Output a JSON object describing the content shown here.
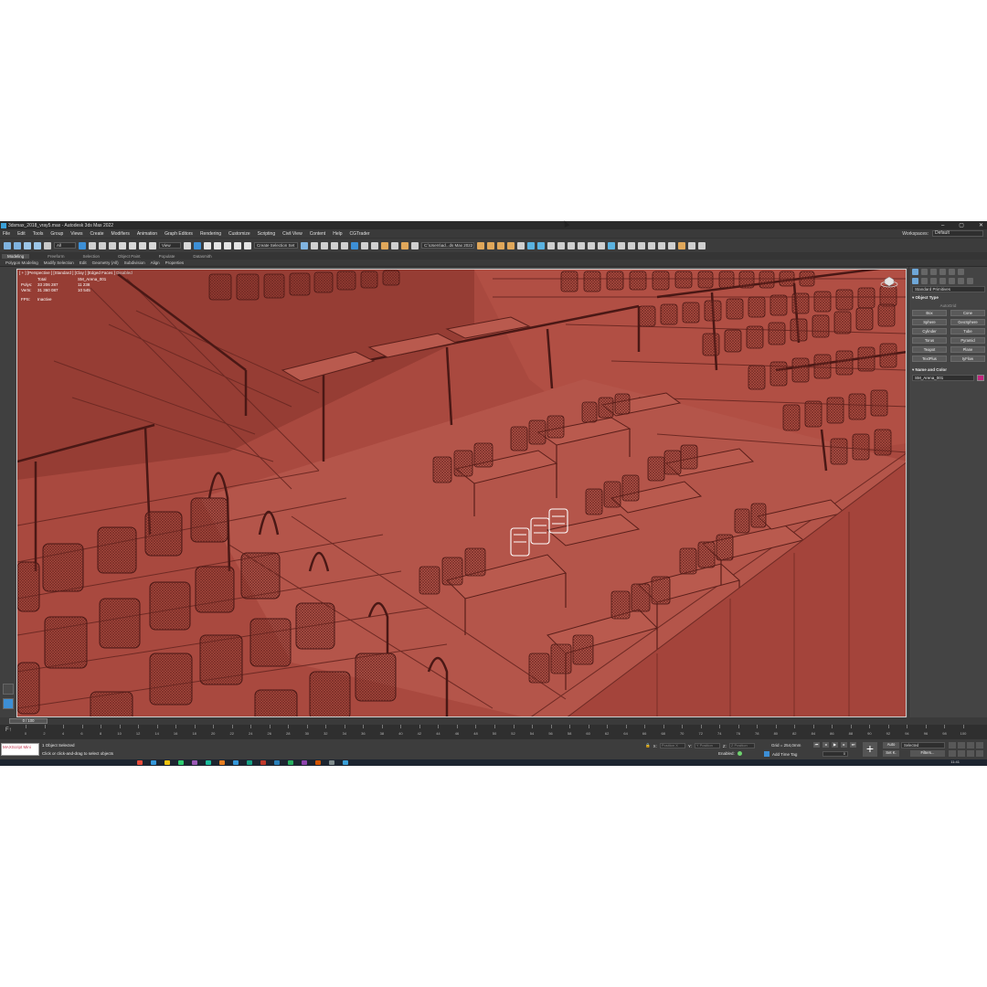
{
  "window": {
    "title": "3dsmax_2018_vray5.max - Autodesk 3ds Max 2022",
    "controls": [
      "–",
      "▢",
      "✕"
    ]
  },
  "menu": {
    "items": [
      "File",
      "Edit",
      "Tools",
      "Group",
      "Views",
      "Create",
      "Modifiers",
      "Animation",
      "Graph Editors",
      "Rendering",
      "Customize",
      "Scripting",
      "Civil View",
      "Content",
      "Help",
      "CGTrader"
    ],
    "workspace_label": "Workspaces:",
    "workspace_value": "Default"
  },
  "toolbar": {
    "filter_value": "All",
    "view_value": "View",
    "selection_set": "Create Selection Set",
    "project_path": "C:\\Users\\ad...ds Max 2022"
  },
  "ribbon": {
    "tabs": [
      "Modeling",
      "Freeform",
      "Selection",
      "Object Paint",
      "Populate",
      "Datasmith"
    ],
    "active_tab": "Modeling",
    "sub_items": [
      "Polygon Modeling",
      "Modify Selection",
      "Edit",
      "Geometry (All)",
      "Subdivision",
      "Align",
      "Properties"
    ]
  },
  "viewport": {
    "label": "[ + ] [Perspective ] [Standard ] [Clay ] [Edged Faces ]",
    "disabled_label": "Disabled",
    "stats": {
      "header_total": "Total",
      "header_object": "SM_Arena_001",
      "polys_label": "Polys:",
      "polys_total": "33 206 287",
      "polys_object": "11 238",
      "verts_label": "Verts:",
      "verts_total": "31 360 087",
      "verts_object": "10 545",
      "fps_label": "FPS:",
      "fps_value": "Inactive"
    },
    "background_color": "#a84a40"
  },
  "command_panel": {
    "category": "Standard Primitives",
    "object_type_title": "Object Type",
    "autogrid_label": "AutoGrid",
    "primitives": [
      "Box",
      "Cone",
      "Sphere",
      "GeoSphere",
      "Cylinder",
      "Tube",
      "Torus",
      "Pyramid",
      "Teapot",
      "Plane",
      "TextPlus",
      "tyFlow"
    ],
    "name_color_title": "Name and Color",
    "object_name": "SM_Arena_001",
    "object_color": "#c2257e"
  },
  "timeline": {
    "slider_label": "0 / 100",
    "ticks": [
      "0",
      "2",
      "4",
      "6",
      "8",
      "10",
      "12",
      "14",
      "16",
      "18",
      "20",
      "22",
      "24",
      "26",
      "28",
      "30",
      "32",
      "34",
      "36",
      "38",
      "40",
      "42",
      "44",
      "46",
      "48",
      "50",
      "52",
      "54",
      "56",
      "58",
      "60",
      "62",
      "64",
      "66",
      "68",
      "70",
      "72",
      "74",
      "76",
      "78",
      "80",
      "82",
      "84",
      "86",
      "88",
      "90",
      "92",
      "94",
      "96",
      "98",
      "100"
    ]
  },
  "status": {
    "maxscript_label": "MAXScript Mini",
    "selection_text": "1 Object Selected",
    "prompt_text": "Click or click-and-drag to select objects",
    "x_label": "X:",
    "y_label": "Y:",
    "z_label": "Z:",
    "x_value": "Position X",
    "y_value": "Y Position",
    "z_value": "Z Position",
    "grid_text": "Grid = 254,0mm",
    "enabled_label": "Enabled:",
    "add_time_tag": "Add Time Tag",
    "frame_value": "0",
    "auto_label": "Auto",
    "setk_label": "Set K.",
    "selected_value": "Selected",
    "filters_label": "Filters..."
  },
  "taskbar": {
    "time": "11:41"
  }
}
